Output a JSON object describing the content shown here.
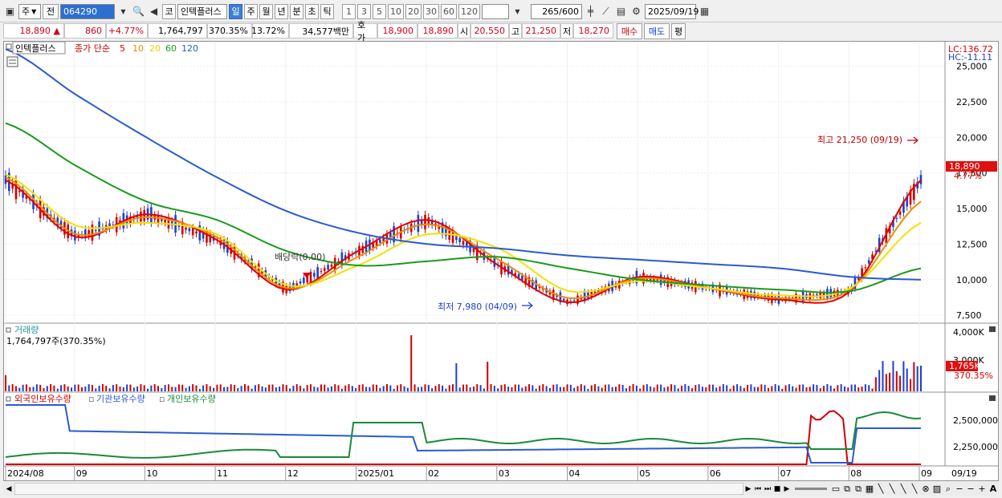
{
  "toolbar1": {
    "market": "주",
    "prev": "전",
    "code": "064290",
    "quote_btn": "코",
    "stock_name": "인텍플러스",
    "periods": [
      "일",
      "주",
      "월",
      "년",
      "분",
      "초",
      "틱"
    ],
    "selected_period": "일",
    "counts": [
      "1",
      "3",
      "5",
      "10",
      "20",
      "30",
      "60",
      "120"
    ],
    "display_count": "265",
    "max_count": "/600",
    "date": "2025/09/19"
  },
  "toolbar2": {
    "price": "18,890",
    "change_arrow": "▲",
    "change": "860",
    "change_pct": "+4.77%",
    "volume": "1,764,797",
    "vol_ratio": "370.35%",
    "turnover": "13.72%",
    "amount": "34,577백만",
    "ask_label": "호가",
    "ask": "18,900",
    "bid": "18,890",
    "open_label": "시",
    "open": "20,550",
    "high_label": "고",
    "high": "21,250",
    "low_label": "저",
    "low": "18,270",
    "buy_btn": "매수",
    "sell_btn": "매도",
    "eval_btn": "평"
  },
  "legend": {
    "name": "인텍플러스",
    "type": "종가 단순",
    "ma": [
      {
        "label": "5",
        "color": "#e00000"
      },
      {
        "label": "10",
        "color": "#f08c00"
      },
      {
        "label": "20",
        "color": "#f2e200"
      },
      {
        "label": "60",
        "color": "#1a9a1a"
      },
      {
        "label": "120",
        "color": "#2a5ad0"
      }
    ]
  },
  "price_axis": {
    "lc": "LC:136.72",
    "hc": "HC:-11.11",
    "ticks": [
      "25,000",
      "22,500",
      "20,000",
      "17,500",
      "15,000",
      "12,500",
      "10,000",
      "7,500"
    ],
    "current": "18,890",
    "current_pct": "4.77%"
  },
  "annotations": {
    "high": "최고 21,250 (09/19)",
    "low": "최저 7,980 (04/09)",
    "dividend": "배당락(0.00)"
  },
  "volume_panel": {
    "title": "거래량",
    "value": "1,764,797주(370.35%)",
    "ticks": [
      "4,000K",
      "3,000K"
    ],
    "current": "1,765K",
    "current_pct": "370.35%"
  },
  "holdings_panel": {
    "series": [
      {
        "label": "외국인보유수량",
        "color": "#cc0000"
      },
      {
        "label": "기관보유수량",
        "color": "#2a5ad0"
      },
      {
        "label": "개인보유수량",
        "color": "#1a8a3a"
      }
    ],
    "ticks": [
      "2,500,000",
      "2,250,000"
    ]
  },
  "x_axis": {
    "labels": [
      "2024/08",
      "09",
      "10",
      "11",
      "12",
      "2025/01",
      "02",
      "03",
      "04",
      "05",
      "06",
      "07",
      "08",
      "09"
    ],
    "end": "09/19"
  },
  "chart_data": [
    {
      "type": "line",
      "title": "",
      "x": [
        "2024/08",
        "2024/09",
        "2024/10",
        "2024/11",
        "2024/12",
        "2025/01",
        "2025/02",
        "2025/03",
        "2025/04",
        "2025/05",
        "2025/06",
        "2025/07",
        "2025/08",
        "2025/09"
      ],
      "ylim": [
        7000,
        26500
      ],
      "series": [
        {
          "name": "5",
          "values": [
            17000,
            13000,
            14600,
            12800,
            9300,
            12000,
            14200,
            11000,
            8400,
            10200,
            9400,
            8600,
            9200,
            17000
          ]
        },
        {
          "name": "10",
          "values": [
            17200,
            13200,
            14400,
            13000,
            9400,
            11600,
            13900,
            11400,
            8700,
            10100,
            9400,
            8700,
            9300,
            15500
          ]
        },
        {
          "name": "20",
          "values": [
            17400,
            13800,
            14000,
            13200,
            9600,
            11000,
            13200,
            12200,
            9200,
            9900,
            9400,
            8900,
            9400,
            14000
          ]
        },
        {
          "name": "60",
          "values": [
            21000,
            18000,
            15500,
            14200,
            12000,
            11000,
            11300,
            11600,
            10800,
            10000,
            9600,
            9300,
            9200,
            10800
          ]
        },
        {
          "name": "120",
          "values": [
            26200,
            23000,
            20000,
            17200,
            14800,
            13300,
            12500,
            12200,
            11700,
            11400,
            11100,
            10800,
            10200,
            10000
          ]
        }
      ],
      "annotations": [
        "최고 21,250 (09/19)",
        "최저 7,980 (04/09)",
        "배당락(0.00)"
      ]
    }
  ],
  "statusbar": {
    "nav": [
      "▶",
      "⏮",
      "⏭",
      "■",
      "▶"
    ]
  }
}
